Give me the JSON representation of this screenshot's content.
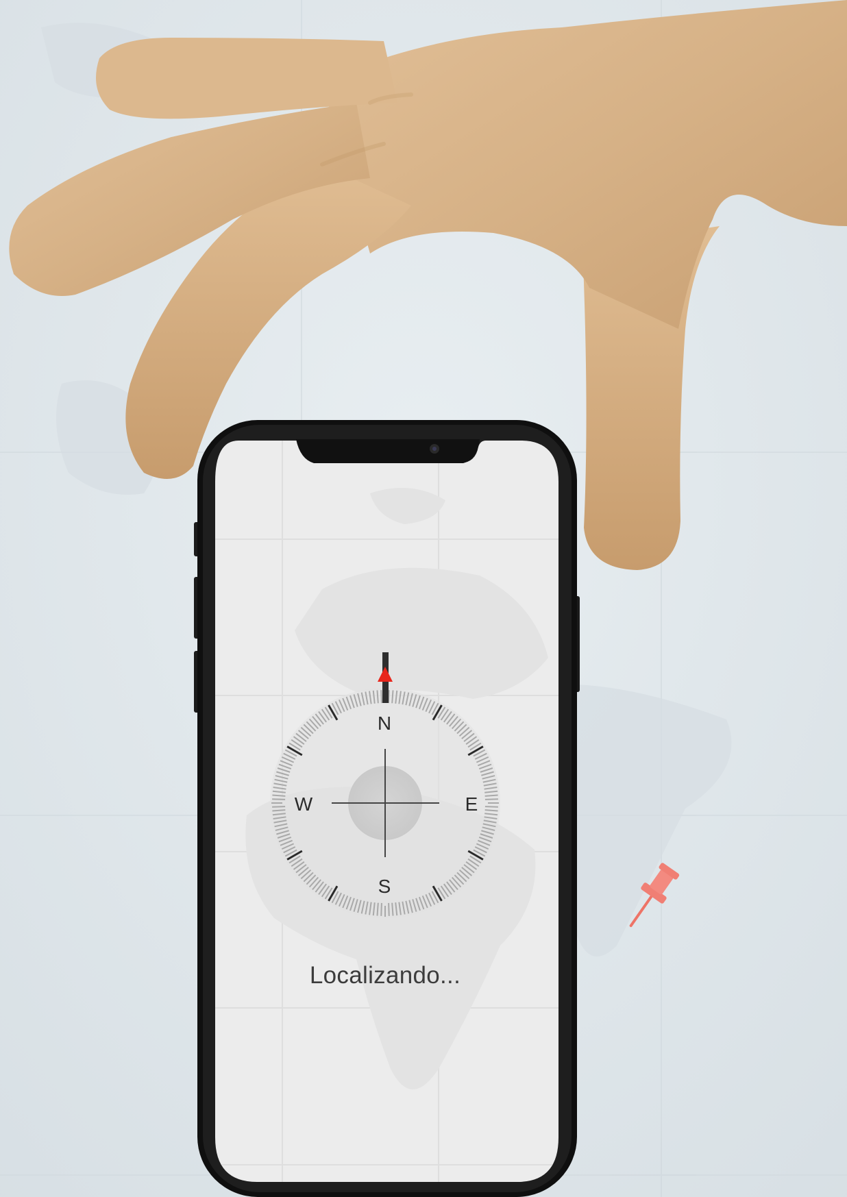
{
  "compass": {
    "north": "N",
    "east": "E",
    "south": "S",
    "west": "W",
    "needle_color": "#e8261c"
  },
  "status": {
    "text": "Localizando..."
  },
  "map_pin": {
    "icon": "pushpin-icon",
    "color": "#f07f74"
  },
  "hand": {
    "skin_color": "#d8b48a"
  }
}
